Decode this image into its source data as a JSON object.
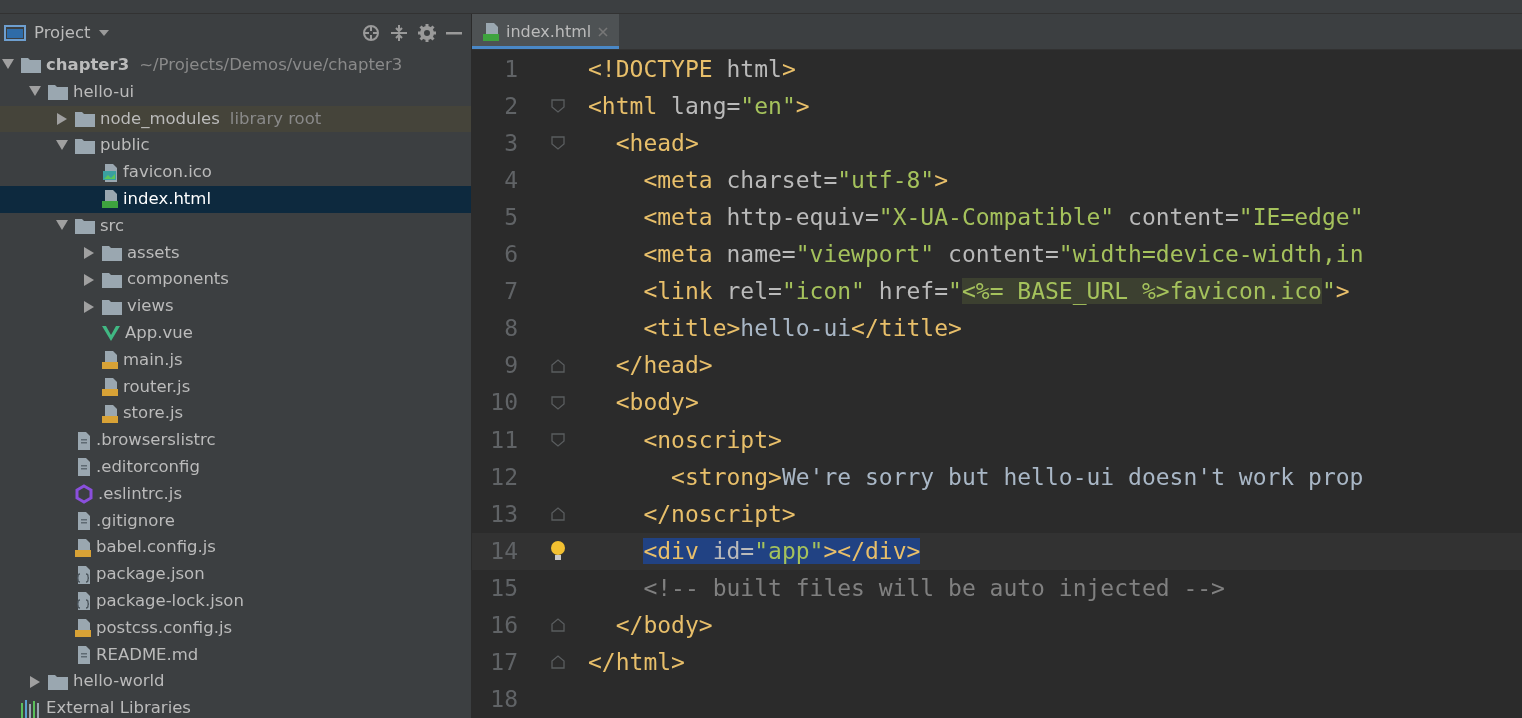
{
  "project_panel": {
    "title": "Project",
    "tree": [
      {
        "label": "chapter3",
        "hint": "~/Projects/Demos/vue/chapter3",
        "kind": "module",
        "expanded": true,
        "selected": false,
        "children": [
          {
            "label": "hello-ui",
            "kind": "folder",
            "expanded": true,
            "selected": false,
            "children": [
              {
                "label": "node_modules",
                "hint": "library root",
                "kind": "library-folder",
                "expanded": false,
                "selected": false
              },
              {
                "label": "public",
                "kind": "folder",
                "expanded": true,
                "selected": false,
                "children": [
                  {
                    "label": "favicon.ico",
                    "kind": "image",
                    "selected": false
                  },
                  {
                    "label": "index.html",
                    "kind": "html",
                    "selected": true
                  }
                ]
              },
              {
                "label": "src",
                "kind": "folder",
                "expanded": true,
                "selected": false,
                "children": [
                  {
                    "label": "assets",
                    "kind": "folder",
                    "expanded": false,
                    "selected": false
                  },
                  {
                    "label": "components",
                    "kind": "folder",
                    "expanded": false,
                    "selected": false
                  },
                  {
                    "label": "views",
                    "kind": "folder",
                    "expanded": false,
                    "selected": false
                  },
                  {
                    "label": "App.vue",
                    "kind": "vue",
                    "selected": false
                  },
                  {
                    "label": "main.js",
                    "kind": "js",
                    "selected": false
                  },
                  {
                    "label": "router.js",
                    "kind": "js",
                    "selected": false
                  },
                  {
                    "label": "store.js",
                    "kind": "js",
                    "selected": false
                  }
                ]
              },
              {
                "label": ".browserslistrc",
                "kind": "text",
                "selected": false
              },
              {
                "label": ".editorconfig",
                "kind": "text",
                "selected": false
              },
              {
                "label": ".eslintrc.js",
                "kind": "eslint",
                "selected": false
              },
              {
                "label": ".gitignore",
                "kind": "text",
                "selected": false
              },
              {
                "label": "babel.config.js",
                "kind": "js",
                "selected": false
              },
              {
                "label": "package.json",
                "kind": "json",
                "selected": false
              },
              {
                "label": "package-lock.json",
                "kind": "json",
                "selected": false
              },
              {
                "label": "postcss.config.js",
                "kind": "js",
                "selected": false
              },
              {
                "label": "README.md",
                "kind": "text",
                "selected": false
              }
            ]
          },
          {
            "label": "hello-world",
            "kind": "folder",
            "expanded": false,
            "selected": false
          }
        ]
      },
      {
        "label": "External Libraries",
        "kind": "libraries",
        "selected": false
      }
    ]
  },
  "editor": {
    "tabs": [
      {
        "label": "index.html",
        "selected": true
      }
    ],
    "lines": [
      {
        "number": "1",
        "kind": "plain",
        "tokens": [
          {
            "kind": "tag",
            "text": "<!DOCTYPE "
          },
          {
            "kind": "attr",
            "text": "html"
          },
          {
            "kind": "tag",
            "text": ">"
          }
        ]
      },
      {
        "number": "2",
        "kind": "fold-start",
        "tokens": [
          {
            "kind": "tag",
            "text": "<html "
          },
          {
            "kind": "attr",
            "text": "lang="
          },
          {
            "kind": "string",
            "text": "\"en\""
          },
          {
            "kind": "tag",
            "text": ">"
          }
        ]
      },
      {
        "number": "3",
        "kind": "fold-start",
        "tokens": [
          {
            "kind": "tag",
            "text": "  <head>"
          }
        ]
      },
      {
        "number": "4",
        "kind": "plain",
        "tokens": [
          {
            "kind": "tag",
            "text": "    <meta "
          },
          {
            "kind": "attr",
            "text": "charset="
          },
          {
            "kind": "string",
            "text": "\"utf-8\""
          },
          {
            "kind": "tag",
            "text": ">"
          }
        ]
      },
      {
        "number": "5",
        "kind": "plain",
        "tokens": [
          {
            "kind": "tag",
            "text": "    <meta "
          },
          {
            "kind": "attr",
            "text": "http-equiv="
          },
          {
            "kind": "string",
            "text": "\"X-UA-Compatible\""
          },
          {
            "kind": "attr",
            "text": " content="
          },
          {
            "kind": "string",
            "text": "\"IE=edge\""
          }
        ]
      },
      {
        "number": "6",
        "kind": "plain",
        "tokens": [
          {
            "kind": "tag",
            "text": "    <meta "
          },
          {
            "kind": "attr",
            "text": "name="
          },
          {
            "kind": "string",
            "text": "\"viewport\""
          },
          {
            "kind": "attr",
            "text": " content="
          },
          {
            "kind": "string",
            "text": "\"width=device-width,in"
          }
        ]
      },
      {
        "number": "7",
        "kind": "plain",
        "tokens": [
          {
            "kind": "tag",
            "text": "    <link "
          },
          {
            "kind": "attr",
            "text": "rel="
          },
          {
            "kind": "string",
            "text": "\"icon\""
          },
          {
            "kind": "attr",
            "text": " href="
          },
          {
            "kind": "string",
            "text": "\""
          },
          {
            "kind": "injected",
            "text": "<%= BASE_URL %>favicon.ico"
          },
          {
            "kind": "string",
            "text": "\""
          },
          {
            "kind": "tag",
            "text": ">"
          }
        ]
      },
      {
        "number": "8",
        "kind": "plain",
        "tokens": [
          {
            "kind": "tag",
            "text": "    <title>"
          },
          {
            "kind": "text",
            "text": "hello-ui"
          },
          {
            "kind": "tag",
            "text": "</title>"
          }
        ]
      },
      {
        "number": "9",
        "kind": "fold-end",
        "tokens": [
          {
            "kind": "tag",
            "text": "  </head>"
          }
        ]
      },
      {
        "number": "10",
        "kind": "fold-start",
        "tokens": [
          {
            "kind": "tag",
            "text": "  <body>"
          }
        ]
      },
      {
        "number": "11",
        "kind": "fold-start",
        "tokens": [
          {
            "kind": "tag",
            "text": "    <noscript>"
          }
        ]
      },
      {
        "number": "12",
        "kind": "plain",
        "tokens": [
          {
            "kind": "tag",
            "text": "      <strong>"
          },
          {
            "kind": "text",
            "text": "We're sorry but hello-ui doesn't work prop"
          }
        ]
      },
      {
        "number": "13",
        "kind": "fold-end",
        "tokens": [
          {
            "kind": "tag",
            "text": "    </noscript>"
          }
        ]
      },
      {
        "number": "14",
        "kind": "bulb",
        "tokens": [
          {
            "kind": "selected-tag",
            "text": "    <div "
          },
          {
            "kind": "selected-attr",
            "text": "id="
          },
          {
            "kind": "selected-string",
            "text": "\"app\""
          },
          {
            "kind": "selected-tag",
            "text": "></div>"
          }
        ]
      },
      {
        "number": "15",
        "kind": "plain",
        "tokens": [
          {
            "kind": "comment",
            "text": "    <!-- built files will be auto injected -->"
          }
        ]
      },
      {
        "number": "16",
        "kind": "fold-end",
        "tokens": [
          {
            "kind": "tag",
            "text": "  </body>"
          }
        ]
      },
      {
        "number": "17",
        "kind": "fold-end",
        "tokens": [
          {
            "kind": "tag",
            "text": "</html>"
          }
        ]
      },
      {
        "number": "18",
        "kind": "plain"
      }
    ]
  }
}
